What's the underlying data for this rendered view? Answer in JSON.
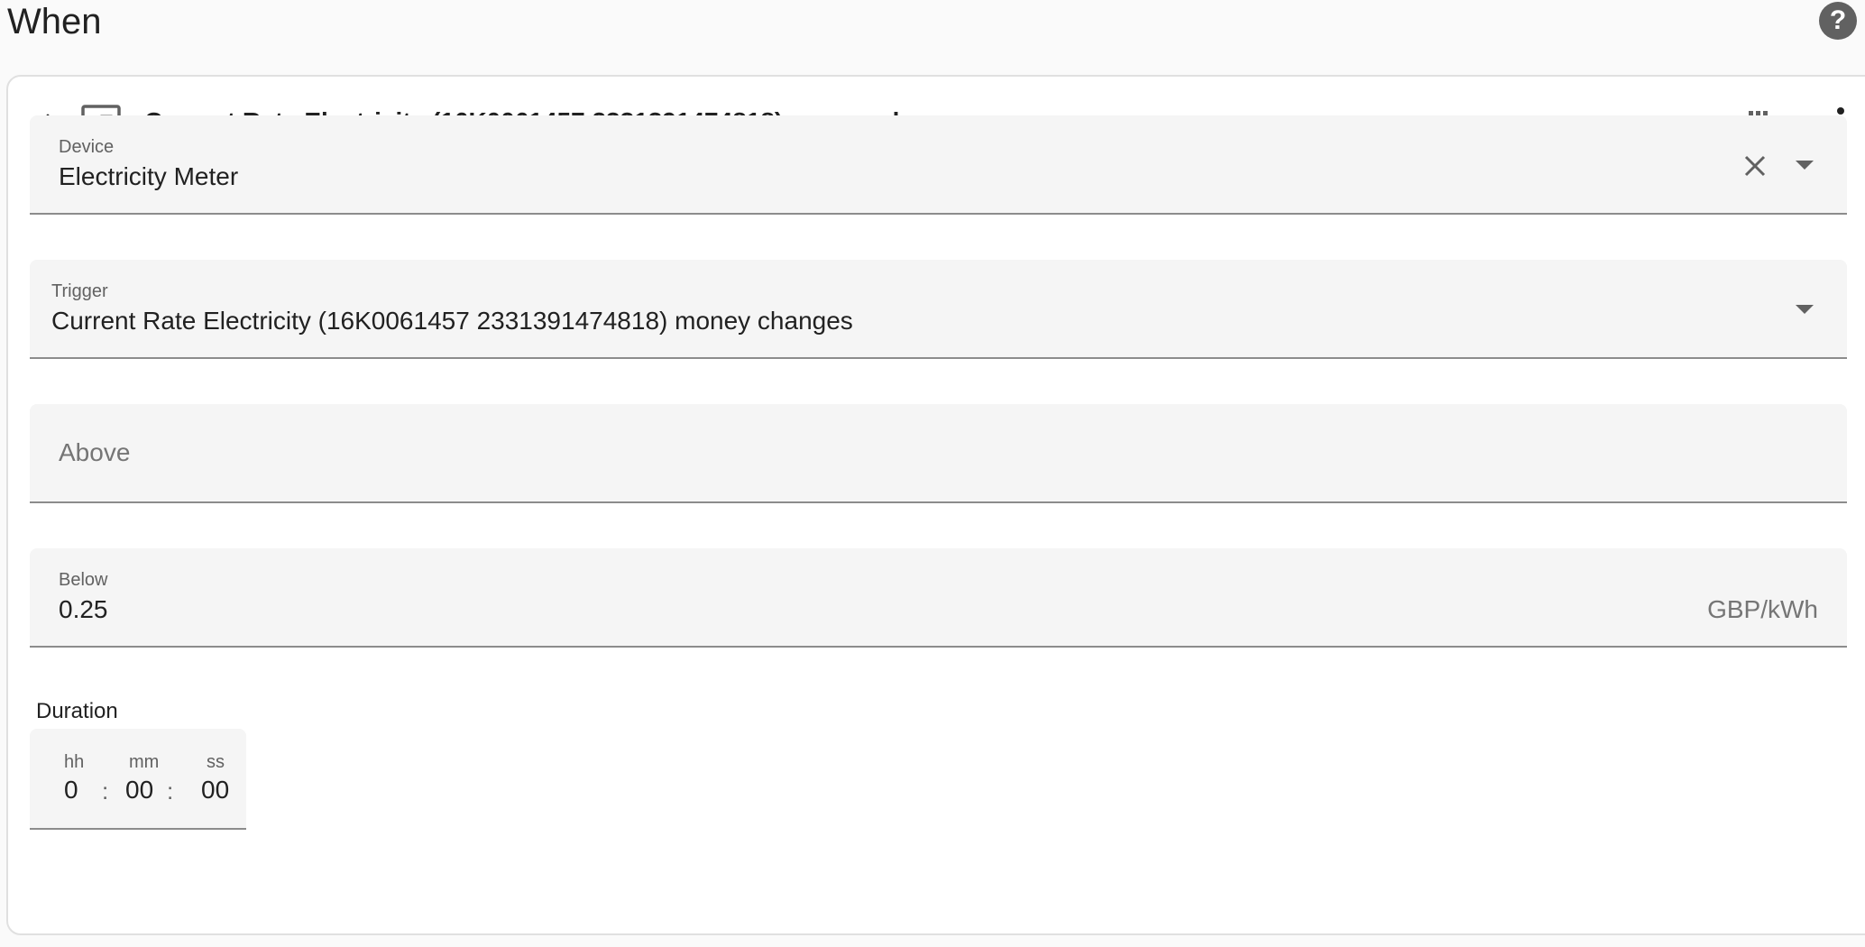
{
  "section": {
    "title": "When"
  },
  "card": {
    "title": "Current Rate Electricity (16K0061457 2331391474818) money changes",
    "icons": [
      "chevron-up-icon",
      "device-icon",
      "drag-handle-icon",
      "more-vertical-icon"
    ]
  },
  "fields": {
    "device": {
      "label": "Device",
      "value": "Electricity Meter"
    },
    "trigger": {
      "label": "Trigger",
      "value": "Current Rate Electricity (16K0061457 2331391474818) money changes"
    },
    "above": {
      "placeholder": "Above"
    },
    "below": {
      "label": "Below",
      "value": "0.25",
      "unit": "GBP/kWh"
    }
  },
  "duration": {
    "label": "Duration",
    "hh_label": "hh",
    "mm_label": "mm",
    "ss_label": "ss",
    "hh": "0",
    "mm": "00",
    "ss": "00",
    "separator": ":"
  },
  "colors": {
    "field_bg": "#f5f5f5",
    "text_primary": "#212121",
    "text_secondary": "#616161",
    "icon": "#616161"
  }
}
